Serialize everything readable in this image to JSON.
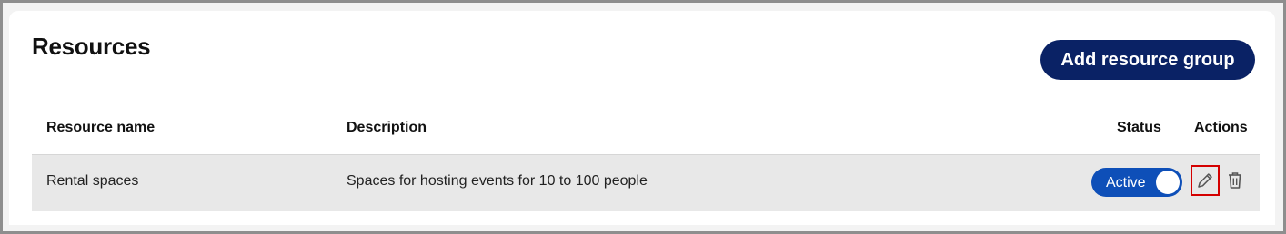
{
  "page": {
    "title": "Resources",
    "add_button_label": "Add resource group"
  },
  "table": {
    "columns": [
      "Resource name",
      "Description",
      "Status",
      "Actions"
    ],
    "rows": [
      {
        "name": "Rental spaces",
        "description": "Spaces for hosting events for 10 to 100 people",
        "status": "Active",
        "status_on": true,
        "actions": [
          "pencil-icon",
          "trash-icon"
        ]
      }
    ]
  },
  "colors": {
    "primary": "#0a2265",
    "toggle": "#0e4fb8",
    "row_background": "#e8e8e8",
    "highlight_border": "#d40000"
  }
}
